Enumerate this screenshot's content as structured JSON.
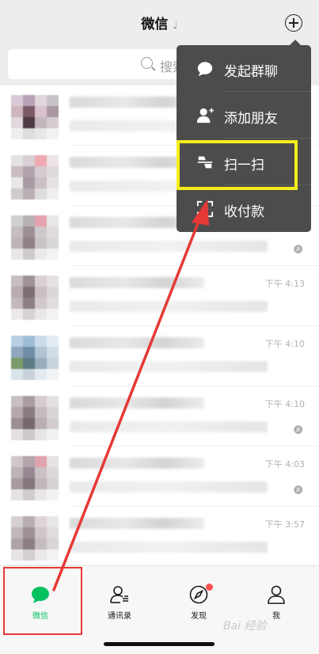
{
  "header": {
    "title": "微信"
  },
  "search": {
    "placeholder": "搜索"
  },
  "chats": [
    {
      "time": "",
      "muted": false,
      "avatar": [
        "#d9cbd6",
        "#b9a1b7",
        "#e0d6dc",
        "#c7c3c8",
        "#cdb5be",
        "#7c5a66",
        "#d8c2cb",
        "#a996a3",
        "#e2d7dd",
        "#4e3a44",
        "#c3b6bd",
        "#d5ccd1",
        "#eee",
        "#ddd",
        "#e7e7e7",
        "#f2f2f2"
      ]
    },
    {
      "time": "",
      "muted": false,
      "avatar": [
        "#e3e1e1",
        "#d7d0d4",
        "#f1a8b0",
        "#ece4e5",
        "#c9bdc2",
        "#b1a3ad",
        "#d6cbd0",
        "#e0d9dc",
        "#e9e6e8",
        "#a79aa2",
        "#c9c1c5",
        "#e7e2e4",
        "#cfcacd",
        "#b8b0b4",
        "#dedcdd",
        "#efeef0"
      ]
    },
    {
      "time": "",
      "muted": true,
      "avatar": [
        "#d1d1d1",
        "#b8b1b5",
        "#e3a2ad",
        "#e7e7e7",
        "#c4bcc0",
        "#9c8f95",
        "#cfc8cb",
        "#dfdadc",
        "#bdb5b8",
        "#8e8288",
        "#c8c3c5",
        "#d9d6d7",
        "#e8e6e7",
        "#cfcbcd",
        "#ece9eb",
        "#f3f3f3"
      ]
    },
    {
      "time": "下午 4:13",
      "muted": false,
      "avatar": [
        "#c5bdc0",
        "#9f9397",
        "#d8d0d3",
        "#e6e2e4",
        "#b7abb0",
        "#7e6e75",
        "#cabfc3",
        "#ddd6d9",
        "#c3b8bc",
        "#8d7f85",
        "#d1c9cc",
        "#e1dcdf",
        "#ece9ea",
        "#d6d1d3",
        "#e9e6e7",
        "#f4f3f3"
      ]
    },
    {
      "time": "下午 4:10",
      "muted": false,
      "avatar": [
        "#b6cfe3",
        "#9fbcd7",
        "#c9dbe9",
        "#e3ecf3",
        "#8fa7bd",
        "#6f8ea6",
        "#b2c4d3",
        "#d0dde7",
        "#7b9a6a",
        "#5e7b86",
        "#98adbd",
        "#c6d2dc",
        "#dbe3ea",
        "#c8d2da",
        "#e5eaee",
        "#f1f4f6"
      ]
    },
    {
      "time": "下午 4:10",
      "muted": true,
      "avatar": [
        "#c6c0c3",
        "#a99da3",
        "#d4ccd0",
        "#e5e1e3",
        "#b4a8ae",
        "#8a7c83",
        "#c5bbc0",
        "#dad4d7",
        "#9b8f95",
        "#776870",
        "#b9b0b4",
        "#d2ccd0",
        "#e4e0e2",
        "#cdc7ca",
        "#e7e4e6",
        "#f2f1f1"
      ]
    },
    {
      "time": "下午 4:03",
      "muted": true,
      "avatar": [
        "#cfc7ca",
        "#b2a6ab",
        "#e0a3ad",
        "#e7e3e5",
        "#bdb2b7",
        "#958890",
        "#cac1c5",
        "#ddd7da",
        "#a79ba1",
        "#84767d",
        "#c0b7bb",
        "#d6d0d3",
        "#e6e2e4",
        "#d0cbce",
        "#e9e6e8",
        "#f3f2f2"
      ]
    },
    {
      "time": "下午 3:57",
      "muted": false,
      "avatar": [
        "#d5cfd2",
        "#b8adb2",
        "#dcd4d8",
        "#e9e6e7",
        "#c2b8bc",
        "#9d9096",
        "#cec6ca",
        "#e0dbdd",
        "#aea3a8",
        "#8b7e85",
        "#c4bcc0",
        "#d9d4d6",
        "#e7e4e5",
        "#d3cfd1",
        "#ebe8ea",
        "#f4f3f3"
      ]
    }
  ],
  "menu": [
    {
      "label": "发起群聊",
      "icon": "chat-bubble-icon"
    },
    {
      "label": "添加朋友",
      "icon": "add-friend-icon"
    },
    {
      "label": "扫一扫",
      "icon": "scan-icon"
    },
    {
      "label": "收付款",
      "icon": "payment-icon"
    }
  ],
  "tabs": [
    {
      "label": "微信",
      "icon": "chat-bubble-icon",
      "active": true
    },
    {
      "label": "通讯录",
      "icon": "contacts-icon",
      "active": false
    },
    {
      "label": "发现",
      "icon": "compass-icon",
      "active": false,
      "badge": true
    },
    {
      "label": "我",
      "icon": "person-icon",
      "active": false
    }
  ],
  "colors": {
    "accent": "#07c160",
    "menu_bg": "#4c4c4c",
    "highlight": "#f5ee1a",
    "arrow": "#e53935",
    "badge": "#fa5151"
  },
  "watermark": "Bai 经验"
}
